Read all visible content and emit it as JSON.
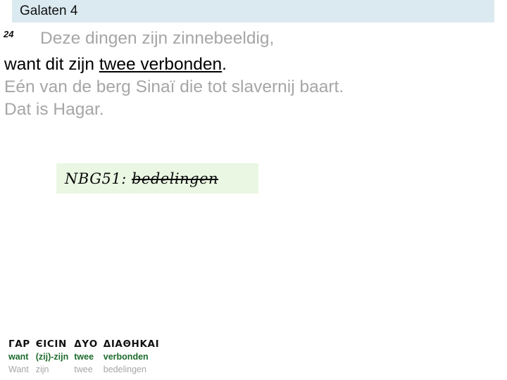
{
  "slide": {
    "title": "Galaten 4"
  },
  "verse": {
    "number": "24",
    "lines": [
      {
        "text": "Deze dingen zijn zinnebeeldig,",
        "style": "muted"
      },
      {
        "prefix": "want dit zijn ",
        "underlined": "twee verbonden",
        "suffix": ".",
        "style": "emphasis"
      },
      {
        "text": "Eén van de berg Sinaï die tot slavernij baart.",
        "style": "muted"
      },
      {
        "text": "Dat is Hagar.",
        "style": "muted"
      }
    ]
  },
  "note": {
    "label": "NBG51: ",
    "struck_word": "bedelingen",
    "background": "#eaf7e3"
  },
  "interlinear": {
    "greek": [
      "ΓΑΡ",
      "ЄΙCΙΝ",
      "ΔΥΟ",
      "ΔΙΑΘΗΚΑΙ"
    ],
    "gloss": [
      "want",
      "(zij)-zijn",
      "twee",
      "verbonden"
    ],
    "nbg": [
      "Want",
      "zijn",
      "twee",
      "bedelingen"
    ],
    "gloss_color": "#1d6b2c",
    "nbg_color": "#a6a6a6"
  },
  "colors": {
    "title_bar": "#dbeaf0",
    "muted_text": "#a6a6a6",
    "body_text": "#000000"
  }
}
